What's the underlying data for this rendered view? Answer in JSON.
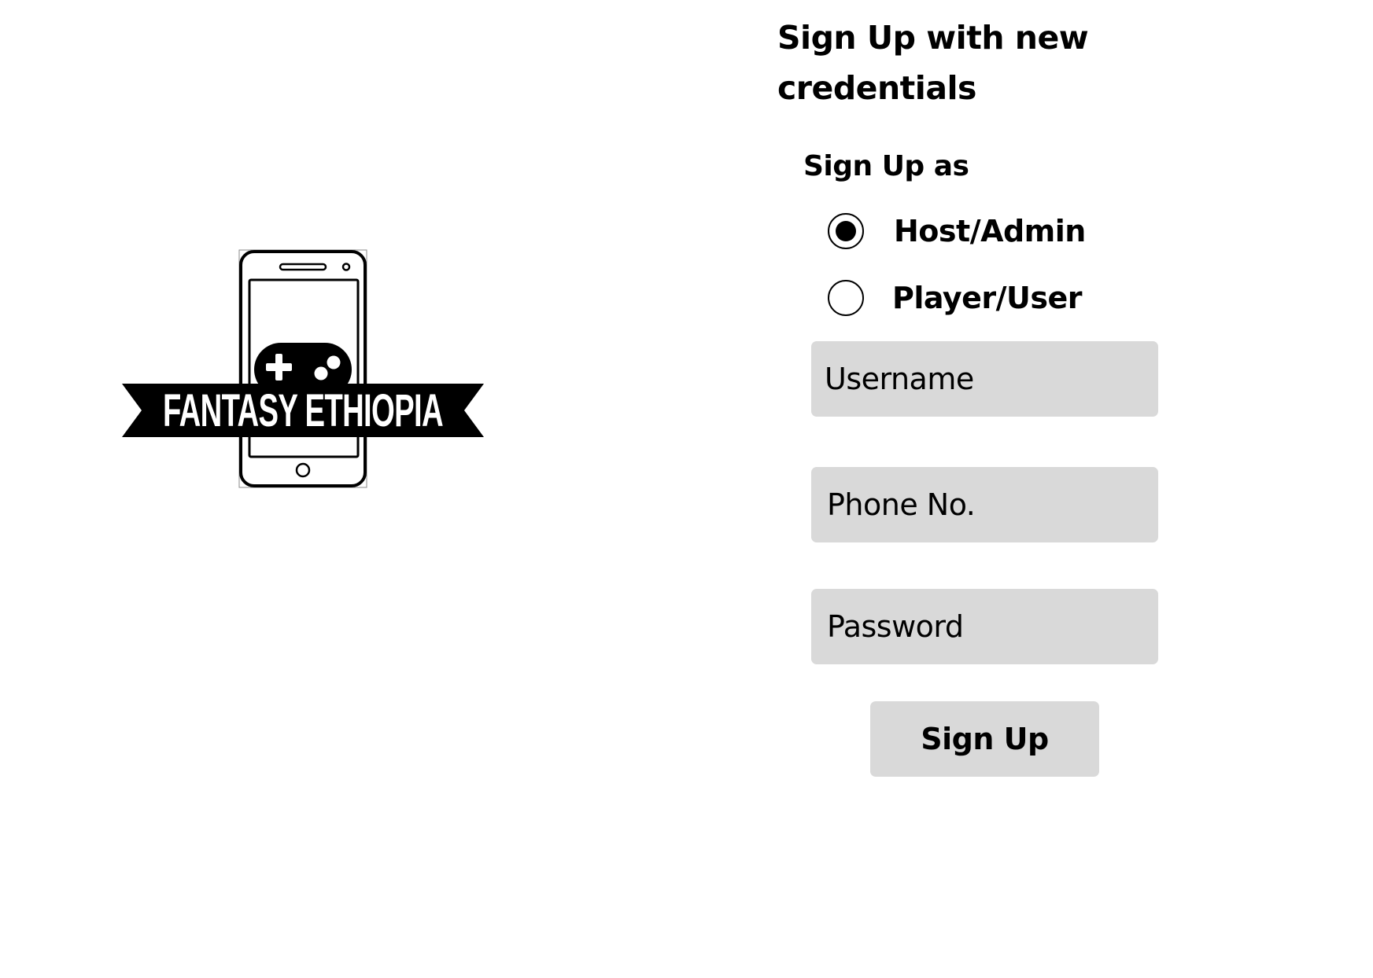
{
  "logo": {
    "text": "FANTASY ETHIOPIA"
  },
  "form": {
    "title": "Sign Up with new credentials",
    "signup_as_label": "Sign Up as",
    "roles": [
      {
        "label": "Host/Admin",
        "selected": true
      },
      {
        "label": "Player/User",
        "selected": false
      }
    ],
    "fields": {
      "username": {
        "placeholder": "Username",
        "value": ""
      },
      "phone": {
        "placeholder": "Phone No.",
        "value": ""
      },
      "password": {
        "placeholder": "Password",
        "value": ""
      }
    },
    "submit_label": "Sign Up"
  },
  "colors": {
    "field_background": "#d9d9d9",
    "text": "#000000",
    "page_background": "#ffffff",
    "logo_primary": "#000000"
  },
  "icons": {
    "logo_icons": [
      "smartphone-icon",
      "gamepad-icon",
      "ribbon-banner"
    ]
  }
}
